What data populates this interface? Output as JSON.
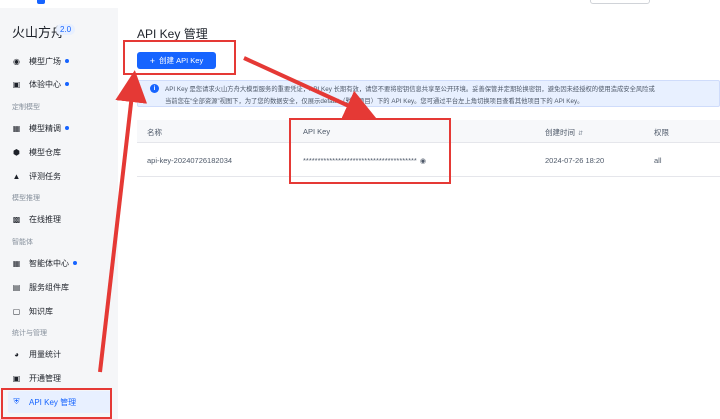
{
  "brand": {
    "name": "火山方舟",
    "version": "2.0"
  },
  "sidebar": {
    "items": [
      {
        "label": "模型广场",
        "icon": "model-square-icon",
        "dot": true
      },
      {
        "label": "体验中心",
        "icon": "experience-icon",
        "dot": true
      },
      {
        "group": "定制模型"
      },
      {
        "label": "模型精调",
        "icon": "finetune-icon",
        "dot": true
      },
      {
        "label": "模型仓库",
        "icon": "cube-icon",
        "dot": false
      },
      {
        "label": "评测任务",
        "icon": "flask-icon",
        "dot": false
      },
      {
        "group": "模型推理"
      },
      {
        "label": "在线推理",
        "icon": "chart-icon",
        "dot": false
      },
      {
        "group": "智能体"
      },
      {
        "label": "智能体中心",
        "icon": "grid-icon",
        "dot": true
      },
      {
        "label": "服务组件库",
        "icon": "stack-icon",
        "dot": false
      },
      {
        "label": "知识库",
        "icon": "book-icon",
        "dot": false
      },
      {
        "group": "统计与管理"
      },
      {
        "label": "用量统计",
        "icon": "gauge-icon",
        "dot": false
      },
      {
        "label": "开通管理",
        "icon": "calendar-icon",
        "dot": false
      },
      {
        "label": "API Key 管理",
        "icon": "shield-icon",
        "dot": false,
        "active": true
      }
    ]
  },
  "main": {
    "title": "API Key 管理",
    "create_button": "创建 API Key",
    "notice": {
      "line1": "API Key 是您请求火山方舟大模型服务的重要凭证，API Key 长期有效，请您不要将密钥信息共享至公开环境。妥善保管并定期轮换密钥，避免因未经授权的使用造成安全风险或",
      "line2": "当前您在“全部资源”视图下，为了您的数据安全，仅展示default（默认项目）下的 API Key。您可通过平台左上角切换项目查看其他项目下的 API Key。"
    },
    "table": {
      "headers": [
        "名称",
        "API Key",
        "创建时间",
        "权限"
      ],
      "rows": [
        {
          "name": "api-key-20240726182034",
          "key": "***************************************",
          "created": "2024-07-26 18:20",
          "permission": "all"
        }
      ]
    }
  },
  "colors": {
    "accent": "#1664ff",
    "annotation": "#e53935"
  }
}
